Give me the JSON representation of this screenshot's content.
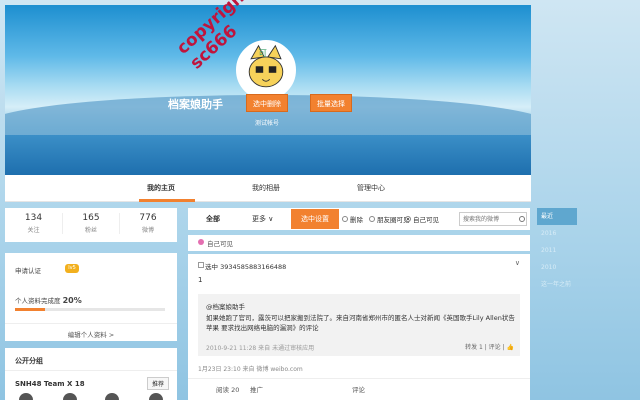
{
  "profile": {
    "name": "档案娘助手",
    "verified_text": "测试帐号",
    "btn_delete": "选中删除",
    "btn_batch": "批量选择",
    "watermark": "copyright sc666"
  },
  "nav": {
    "tabs": [
      "我的主页",
      "我的相册",
      "管理中心"
    ],
    "active": 0
  },
  "stats": [
    {
      "num": "134",
      "label": "关注"
    },
    {
      "num": "165",
      "label": "粉丝"
    },
    {
      "num": "776",
      "label": "微博"
    }
  ],
  "sidebar": {
    "verify_label": "申请认证",
    "level_badge": "lv5",
    "completeness_label": "个人资料完成度",
    "completeness_value": "20%",
    "completeness_fraction": 0.2,
    "edit_link": "编辑个人资料 >"
  },
  "groups": {
    "title": "公开分组",
    "name": "SNH48 Team X 18",
    "recommend": "推荐"
  },
  "feed": {
    "tab_all": "全部",
    "tab_more": "更多 ∨",
    "select_btn": "选中设置",
    "radios": [
      "删除",
      "朋友圈可见",
      "自己可见"
    ],
    "radio_selected": 2,
    "search_placeholder": "搜索我的微博",
    "visibility": "自己可见",
    "post": {
      "check_label": "选中 3934585883166488",
      "text": "1",
      "repost_author": "@档案娘助手",
      "repost_body": "如果她跑了官司，露茨可以把家搬到法院了。来自河南省郑州市的匿名人士对新闻《英国歌手Lily Allen状告苹果 要求找出网络电脑的漏洞》的评论",
      "repost_meta": "2010-9-21 11:28 来自 未通过审核应用",
      "repost_actions": "转发 1 | 评论 | 👍",
      "footer": "1月23日 23:10 来自 微博 weibo.com",
      "read_count": "阅读 20",
      "promote": "推广",
      "comment": "评论"
    }
  },
  "years": [
    "最近",
    "2016",
    "2011",
    "2010",
    "这一年之前"
  ],
  "colors": {
    "accent": "#f2812f",
    "page_bg": "#a9d3ea"
  }
}
